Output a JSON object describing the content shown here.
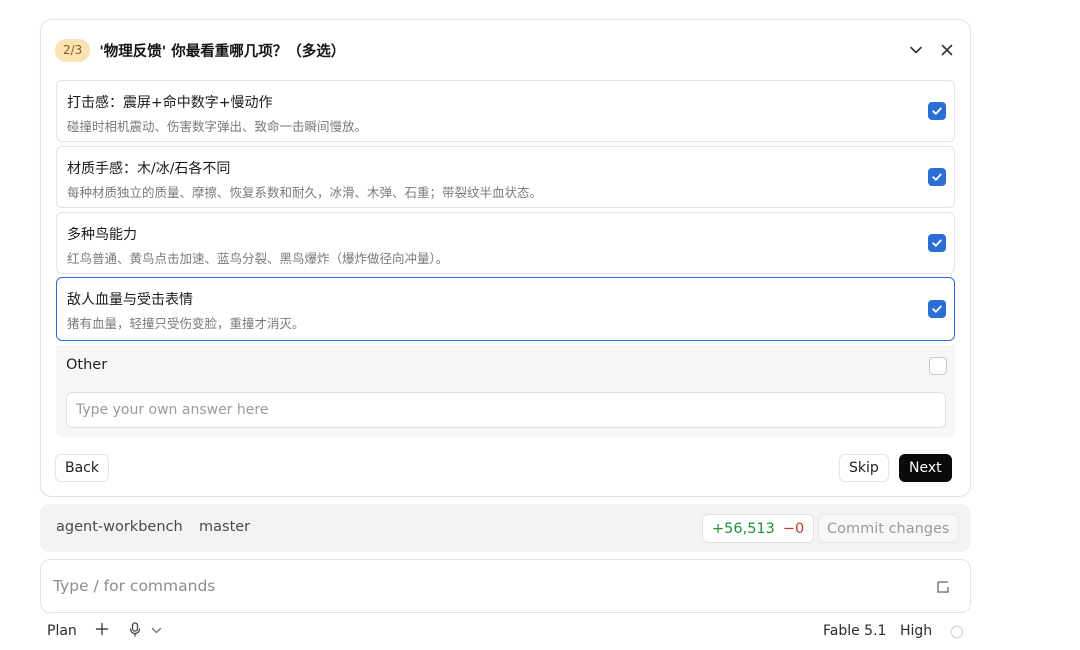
{
  "question": {
    "step": "2/3",
    "title": "'物理反馈' 你最看重哪几项？（多选）"
  },
  "options": [
    {
      "title": "打击感：震屏+命中数字+慢动作",
      "desc": "碰撞时相机震动、伤害数字弹出、致命一击瞬间慢放。",
      "checked": true
    },
    {
      "title": "材质手感：木/冰/石各不同",
      "desc": "每种材质独立的质量、摩擦、恢复系数和耐久，冰滑、木弹、石重；带裂纹半血状态。",
      "checked": true
    },
    {
      "title": "多种鸟能力",
      "desc": "红鸟普通、黄鸟点击加速、蓝鸟分裂、黑鸟爆炸（爆炸做径向冲量）。",
      "checked": true
    },
    {
      "title": "敌人血量与受击表情",
      "desc": "猪有血量，轻撞只受伤变脸，重撞才消灭。",
      "checked": true
    }
  ],
  "other": {
    "label": "Other",
    "placeholder": "Type your own answer here"
  },
  "buttons": {
    "back": "Back",
    "skip": "Skip",
    "next": "Next"
  },
  "git": {
    "repo": "agent-workbench",
    "branch": "master",
    "additions": "+56,513",
    "deletions": "−0",
    "commit": "Commit changes"
  },
  "command": {
    "placeholder": "Type / for commands"
  },
  "footer": {
    "mode": "Plan",
    "model": "Fable 5.1",
    "effort": "High"
  },
  "colors": {
    "accent": "#2b6fd6",
    "badge_bg": "#fbe3b3",
    "additions": "#1e8f3c",
    "deletions": "#c0392b"
  }
}
